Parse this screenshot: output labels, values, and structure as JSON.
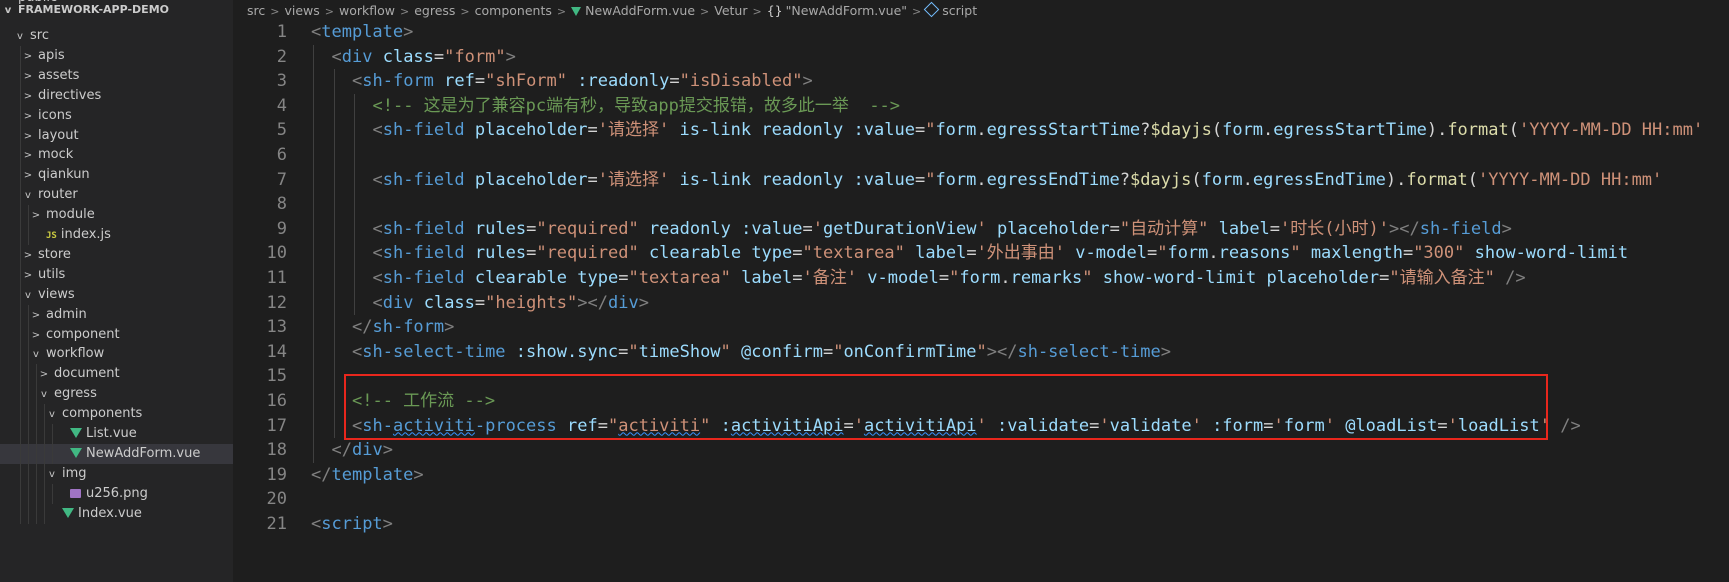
{
  "explorer": {
    "top_cut": "public",
    "project": "FRAMEWORK-APP-DEMO",
    "items": [
      {
        "label": "src",
        "depth": 0,
        "kind": "folder-open",
        "chev": "v"
      },
      {
        "label": "apis",
        "depth": 1,
        "kind": "folder",
        "chev": ">"
      },
      {
        "label": "assets",
        "depth": 1,
        "kind": "folder",
        "chev": ">"
      },
      {
        "label": "directives",
        "depth": 1,
        "kind": "folder",
        "chev": ">"
      },
      {
        "label": "icons",
        "depth": 1,
        "kind": "folder",
        "chev": ">"
      },
      {
        "label": "layout",
        "depth": 1,
        "kind": "folder",
        "chev": ">"
      },
      {
        "label": "mock",
        "depth": 1,
        "kind": "folder",
        "chev": ">"
      },
      {
        "label": "qiankun",
        "depth": 1,
        "kind": "folder",
        "chev": ">"
      },
      {
        "label": "router",
        "depth": 1,
        "kind": "folder-open",
        "chev": "v"
      },
      {
        "label": "module",
        "depth": 2,
        "kind": "folder",
        "chev": ">"
      },
      {
        "label": "index.js",
        "depth": 2,
        "kind": "js",
        "chev": ""
      },
      {
        "label": "store",
        "depth": 1,
        "kind": "folder",
        "chev": ">"
      },
      {
        "label": "utils",
        "depth": 1,
        "kind": "folder",
        "chev": ">"
      },
      {
        "label": "views",
        "depth": 1,
        "kind": "folder-open",
        "chev": "v"
      },
      {
        "label": "admin",
        "depth": 2,
        "kind": "folder",
        "chev": ">"
      },
      {
        "label": "component",
        "depth": 2,
        "kind": "folder",
        "chev": ">"
      },
      {
        "label": "workflow",
        "depth": 2,
        "kind": "folder-open",
        "chev": "v"
      },
      {
        "label": "document",
        "depth": 3,
        "kind": "folder",
        "chev": ">"
      },
      {
        "label": "egress",
        "depth": 3,
        "kind": "folder-open",
        "chev": "v"
      },
      {
        "label": "components",
        "depth": 4,
        "kind": "folder-open",
        "chev": "v"
      },
      {
        "label": "List.vue",
        "depth": 5,
        "kind": "vue",
        "chev": ""
      },
      {
        "label": "NewAddForm.vue",
        "depth": 5,
        "kind": "vue",
        "chev": "",
        "selected": true
      },
      {
        "label": "img",
        "depth": 4,
        "kind": "folder-open",
        "chev": "v"
      },
      {
        "label": "u256.png",
        "depth": 5,
        "kind": "png",
        "chev": ""
      },
      {
        "label": "Index.vue",
        "depth": 4,
        "kind": "vue",
        "chev": ""
      }
    ]
  },
  "breadcrumb": {
    "parts": [
      "src",
      "views",
      "workflow",
      "egress",
      "components"
    ],
    "file": "NewAddForm.vue",
    "vetur": "Vetur",
    "braces": "{}",
    "object": "\"NewAddForm.vue\"",
    "symbol": "script"
  },
  "code_lines": [
    {
      "n": "1",
      "indent": 0,
      "tokens": [
        [
          "t-pun",
          "<"
        ],
        [
          "t-tag",
          "template"
        ],
        [
          "t-pun",
          ">"
        ]
      ]
    },
    {
      "n": "2",
      "indent": 1,
      "tokens": [
        [
          "t-pun",
          "<"
        ],
        [
          "t-tag",
          "div"
        ],
        [
          "t-txt",
          " "
        ],
        [
          "t-attr",
          "class"
        ],
        [
          "t-txt",
          "="
        ],
        [
          "t-str",
          "\"form\""
        ],
        [
          "t-pun",
          ">"
        ]
      ]
    },
    {
      "n": "3",
      "indent": 2,
      "tokens": [
        [
          "t-pun",
          "<"
        ],
        [
          "t-tag",
          "sh-form"
        ],
        [
          "t-txt",
          " "
        ],
        [
          "t-attr",
          "ref"
        ],
        [
          "t-txt",
          "="
        ],
        [
          "t-str",
          "\"shForm\""
        ],
        [
          "t-txt",
          " "
        ],
        [
          "t-attr",
          ":readonly"
        ],
        [
          "t-txt",
          "="
        ],
        [
          "t-str",
          "\"isDisabled\""
        ],
        [
          "t-pun",
          ">"
        ]
      ]
    },
    {
      "n": "4",
      "indent": 3,
      "tokens": [
        [
          "t-com",
          "<!-- 这是为了兼容pc端有秒，导致app提交报错，故多此一举  -->"
        ]
      ]
    },
    {
      "n": "5",
      "indent": 3,
      "tokens": [
        [
          "t-pun",
          "<"
        ],
        [
          "t-tag",
          "sh-field"
        ],
        [
          "t-txt",
          " "
        ],
        [
          "t-attr",
          "placeholder"
        ],
        [
          "t-txt",
          "="
        ],
        [
          "t-str",
          "'请选择'"
        ],
        [
          "t-txt",
          " "
        ],
        [
          "t-attr",
          "is-link"
        ],
        [
          "t-txt",
          " "
        ],
        [
          "t-attr",
          "readonly"
        ],
        [
          "t-txt",
          " "
        ],
        [
          "t-attr",
          ":value"
        ],
        [
          "t-txt",
          "="
        ],
        [
          "t-str",
          "\""
        ],
        [
          "t-attr",
          "form"
        ],
        [
          "t-txt",
          "."
        ],
        [
          "t-attr",
          "egressStartTime"
        ],
        [
          "t-txt",
          "?"
        ],
        [
          "t-fn",
          "$dayjs"
        ],
        [
          "t-txt",
          "("
        ],
        [
          "t-attr",
          "form"
        ],
        [
          "t-txt",
          "."
        ],
        [
          "t-attr",
          "egressStartTime"
        ],
        [
          "t-txt",
          ")."
        ],
        [
          "t-fn",
          "format"
        ],
        [
          "t-txt",
          "("
        ],
        [
          "t-str",
          "'YYYY-MM-DD HH:mm'"
        ]
      ]
    },
    {
      "n": "6",
      "indent": 3,
      "tokens": []
    },
    {
      "n": "7",
      "indent": 3,
      "tokens": [
        [
          "t-pun",
          "<"
        ],
        [
          "t-tag",
          "sh-field"
        ],
        [
          "t-txt",
          " "
        ],
        [
          "t-attr",
          "placeholder"
        ],
        [
          "t-txt",
          "="
        ],
        [
          "t-str",
          "'请选择'"
        ],
        [
          "t-txt",
          " "
        ],
        [
          "t-attr",
          "is-link"
        ],
        [
          "t-txt",
          " "
        ],
        [
          "t-attr",
          "readonly"
        ],
        [
          "t-txt",
          " "
        ],
        [
          "t-attr",
          ":value"
        ],
        [
          "t-txt",
          "="
        ],
        [
          "t-str",
          "\""
        ],
        [
          "t-attr",
          "form"
        ],
        [
          "t-txt",
          "."
        ],
        [
          "t-attr",
          "egressEndTime"
        ],
        [
          "t-txt",
          "?"
        ],
        [
          "t-fn",
          "$dayjs"
        ],
        [
          "t-txt",
          "("
        ],
        [
          "t-attr",
          "form"
        ],
        [
          "t-txt",
          "."
        ],
        [
          "t-attr",
          "egressEndTime"
        ],
        [
          "t-txt",
          ")."
        ],
        [
          "t-fn",
          "format"
        ],
        [
          "t-txt",
          "("
        ],
        [
          "t-str",
          "'YYYY-MM-DD HH:mm'"
        ]
      ]
    },
    {
      "n": "8",
      "indent": 3,
      "tokens": []
    },
    {
      "n": "9",
      "indent": 3,
      "tokens": [
        [
          "t-pun",
          "<"
        ],
        [
          "t-tag",
          "sh-field"
        ],
        [
          "t-txt",
          " "
        ],
        [
          "t-attr",
          "rules"
        ],
        [
          "t-txt",
          "="
        ],
        [
          "t-str",
          "\"required\""
        ],
        [
          "t-txt",
          " "
        ],
        [
          "t-attr",
          "readonly"
        ],
        [
          "t-txt",
          " "
        ],
        [
          "t-attr",
          ":value"
        ],
        [
          "t-txt",
          "="
        ],
        [
          "t-str",
          "'"
        ],
        [
          "t-attr",
          "getDurationView"
        ],
        [
          "t-str",
          "'"
        ],
        [
          "t-txt",
          " "
        ],
        [
          "t-attr",
          "placeholder"
        ],
        [
          "t-txt",
          "="
        ],
        [
          "t-str",
          "\"自动计算\""
        ],
        [
          "t-txt",
          " "
        ],
        [
          "t-attr",
          "label"
        ],
        [
          "t-txt",
          "="
        ],
        [
          "t-str",
          "'时长(小时)'"
        ],
        [
          "t-pun",
          "></"
        ],
        [
          "t-tag",
          "sh-field"
        ],
        [
          "t-pun",
          ">"
        ]
      ]
    },
    {
      "n": "10",
      "indent": 3,
      "tokens": [
        [
          "t-pun",
          "<"
        ],
        [
          "t-tag",
          "sh-field"
        ],
        [
          "t-txt",
          " "
        ],
        [
          "t-attr",
          "rules"
        ],
        [
          "t-txt",
          "="
        ],
        [
          "t-str",
          "\"required\""
        ],
        [
          "t-txt",
          " "
        ],
        [
          "t-attr",
          "clearable"
        ],
        [
          "t-txt",
          " "
        ],
        [
          "t-attr",
          "type"
        ],
        [
          "t-txt",
          "="
        ],
        [
          "t-str",
          "\"textarea\""
        ],
        [
          "t-txt",
          " "
        ],
        [
          "t-attr",
          "label"
        ],
        [
          "t-txt",
          "="
        ],
        [
          "t-str",
          "'外出事由'"
        ],
        [
          "t-txt",
          " "
        ],
        [
          "t-attr",
          "v-model"
        ],
        [
          "t-txt",
          "="
        ],
        [
          "t-str",
          "\""
        ],
        [
          "t-attr",
          "form"
        ],
        [
          "t-txt",
          "."
        ],
        [
          "t-attr",
          "reasons"
        ],
        [
          "t-str",
          "\""
        ],
        [
          "t-txt",
          " "
        ],
        [
          "t-attr",
          "maxlength"
        ],
        [
          "t-txt",
          "="
        ],
        [
          "t-str",
          "\"300\""
        ],
        [
          "t-txt",
          " "
        ],
        [
          "t-attr",
          "show-word-limit"
        ]
      ]
    },
    {
      "n": "11",
      "indent": 3,
      "tokens": [
        [
          "t-pun",
          "<"
        ],
        [
          "t-tag",
          "sh-field"
        ],
        [
          "t-txt",
          " "
        ],
        [
          "t-attr",
          "clearable"
        ],
        [
          "t-txt",
          " "
        ],
        [
          "t-attr",
          "type"
        ],
        [
          "t-txt",
          "="
        ],
        [
          "t-str",
          "\"textarea\""
        ],
        [
          "t-txt",
          " "
        ],
        [
          "t-attr",
          "label"
        ],
        [
          "t-txt",
          "="
        ],
        [
          "t-str",
          "'备注'"
        ],
        [
          "t-txt",
          " "
        ],
        [
          "t-attr",
          "v-model"
        ],
        [
          "t-txt",
          "="
        ],
        [
          "t-str",
          "\""
        ],
        [
          "t-attr",
          "form"
        ],
        [
          "t-txt",
          "."
        ],
        [
          "t-attr",
          "remarks"
        ],
        [
          "t-str",
          "\""
        ],
        [
          "t-txt",
          " "
        ],
        [
          "t-attr",
          "show-word-limit"
        ],
        [
          "t-txt",
          " "
        ],
        [
          "t-attr",
          "placeholder"
        ],
        [
          "t-txt",
          "="
        ],
        [
          "t-str",
          "\"请输入备注\""
        ],
        [
          "t-txt",
          " "
        ],
        [
          "t-pun",
          "/>"
        ]
      ]
    },
    {
      "n": "12",
      "indent": 3,
      "tokens": [
        [
          "t-pun",
          "<"
        ],
        [
          "t-tag",
          "div"
        ],
        [
          "t-txt",
          " "
        ],
        [
          "t-attr",
          "class"
        ],
        [
          "t-txt",
          "="
        ],
        [
          "t-str",
          "\"heights\""
        ],
        [
          "t-pun",
          "></"
        ],
        [
          "t-tag",
          "div"
        ],
        [
          "t-pun",
          ">"
        ]
      ]
    },
    {
      "n": "13",
      "indent": 2,
      "tokens": [
        [
          "t-pun",
          "</"
        ],
        [
          "t-tag",
          "sh-form"
        ],
        [
          "t-pun",
          ">"
        ]
      ]
    },
    {
      "n": "14",
      "indent": 2,
      "tokens": [
        [
          "t-pun",
          "<"
        ],
        [
          "t-tag",
          "sh-select-time"
        ],
        [
          "t-txt",
          " "
        ],
        [
          "t-attr",
          ":show.sync"
        ],
        [
          "t-txt",
          "="
        ],
        [
          "t-str",
          "\""
        ],
        [
          "t-attr",
          "timeShow"
        ],
        [
          "t-str",
          "\""
        ],
        [
          "t-txt",
          " "
        ],
        [
          "t-attr",
          "@confirm"
        ],
        [
          "t-txt",
          "="
        ],
        [
          "t-str",
          "\""
        ],
        [
          "t-attr",
          "onConfirmTime"
        ],
        [
          "t-str",
          "\""
        ],
        [
          "t-pun",
          "></"
        ],
        [
          "t-tag",
          "sh-select-time"
        ],
        [
          "t-pun",
          ">"
        ]
      ]
    },
    {
      "n": "15",
      "indent": 2,
      "tokens": []
    },
    {
      "n": "16",
      "indent": 2,
      "tokens": [
        [
          "t-com",
          "<!-- 工作流 -->"
        ]
      ]
    },
    {
      "n": "17",
      "indent": 2,
      "tokens": [
        [
          "t-pun",
          "<"
        ],
        [
          "t-tag",
          "sh-"
        ],
        [
          "t-tag squig",
          "activiti"
        ],
        [
          "t-tag",
          "-process"
        ],
        [
          "t-txt",
          " "
        ],
        [
          "t-attr",
          "ref"
        ],
        [
          "t-txt",
          "="
        ],
        [
          "t-str",
          "\""
        ],
        [
          "t-str squig",
          "activiti"
        ],
        [
          "t-str",
          "\""
        ],
        [
          "t-txt",
          " "
        ],
        [
          "t-attr",
          ":"
        ],
        [
          "t-attr squig",
          "activitiApi"
        ],
        [
          "t-txt",
          "="
        ],
        [
          "t-str",
          "'"
        ],
        [
          "t-attr squig",
          "activitiApi"
        ],
        [
          "t-str",
          "'"
        ],
        [
          "t-txt",
          " "
        ],
        [
          "t-attr",
          ":validate"
        ],
        [
          "t-txt",
          "="
        ],
        [
          "t-str",
          "'"
        ],
        [
          "t-attr",
          "validate"
        ],
        [
          "t-str",
          "'"
        ],
        [
          "t-txt",
          " "
        ],
        [
          "t-attr",
          ":form"
        ],
        [
          "t-txt",
          "="
        ],
        [
          "t-str",
          "'"
        ],
        [
          "t-attr",
          "form"
        ],
        [
          "t-str",
          "'"
        ],
        [
          "t-txt",
          " "
        ],
        [
          "t-attr",
          "@loadList"
        ],
        [
          "t-txt",
          "="
        ],
        [
          "t-str",
          "'"
        ],
        [
          "t-attr",
          "loadList"
        ],
        [
          "t-str",
          "'"
        ],
        [
          "t-txt",
          " "
        ],
        [
          "t-pun",
          "/>"
        ]
      ]
    },
    {
      "n": "18",
      "indent": 1,
      "tokens": [
        [
          "t-pun",
          "</"
        ],
        [
          "t-tag",
          "div"
        ],
        [
          "t-pun",
          ">"
        ]
      ]
    },
    {
      "n": "19",
      "indent": 0,
      "tokens": [
        [
          "t-pun",
          "</"
        ],
        [
          "t-tag",
          "template"
        ],
        [
          "t-pun",
          ">"
        ]
      ]
    },
    {
      "n": "20",
      "indent": 0,
      "tokens": []
    },
    {
      "n": "21",
      "indent": 0,
      "tokens": [
        [
          "t-pun",
          "<"
        ],
        [
          "t-tag",
          "script"
        ],
        [
          "t-pun",
          ">"
        ]
      ]
    }
  ],
  "colors": {
    "highlight_box": "#e8271d",
    "background": "#1e1e1e",
    "sidebar": "#252526"
  }
}
